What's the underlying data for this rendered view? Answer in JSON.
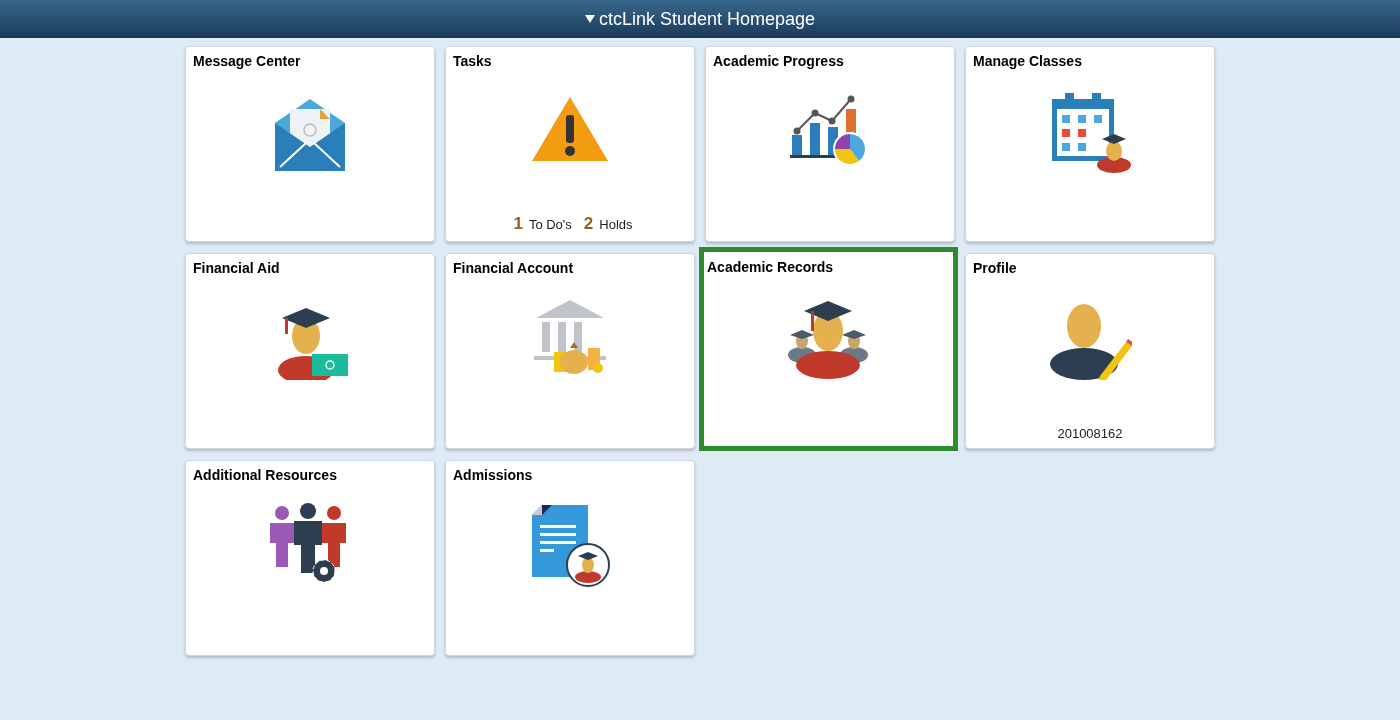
{
  "header": {
    "title": "ctcLink Student Homepage"
  },
  "tiles": [
    {
      "title": "Message Center",
      "kind": "envelope",
      "selected": false
    },
    {
      "title": "Tasks",
      "kind": "warning",
      "selected": false,
      "counts": [
        {
          "number": "1",
          "label": "To Do's"
        },
        {
          "number": "2",
          "label": "Holds"
        }
      ]
    },
    {
      "title": "Academic Progress",
      "kind": "charts",
      "selected": false
    },
    {
      "title": "Manage Classes",
      "kind": "calendar",
      "selected": false
    },
    {
      "title": "Financial Aid",
      "kind": "graduate-money",
      "selected": false
    },
    {
      "title": "Financial Account",
      "kind": "bank",
      "selected": false
    },
    {
      "title": "Academic Records",
      "kind": "graduates",
      "selected": true
    },
    {
      "title": "Profile",
      "kind": "profile",
      "selected": false,
      "footer": "201008162"
    },
    {
      "title": "Additional Resources",
      "kind": "people",
      "selected": false
    },
    {
      "title": "Admissions",
      "kind": "document",
      "selected": false
    }
  ]
}
